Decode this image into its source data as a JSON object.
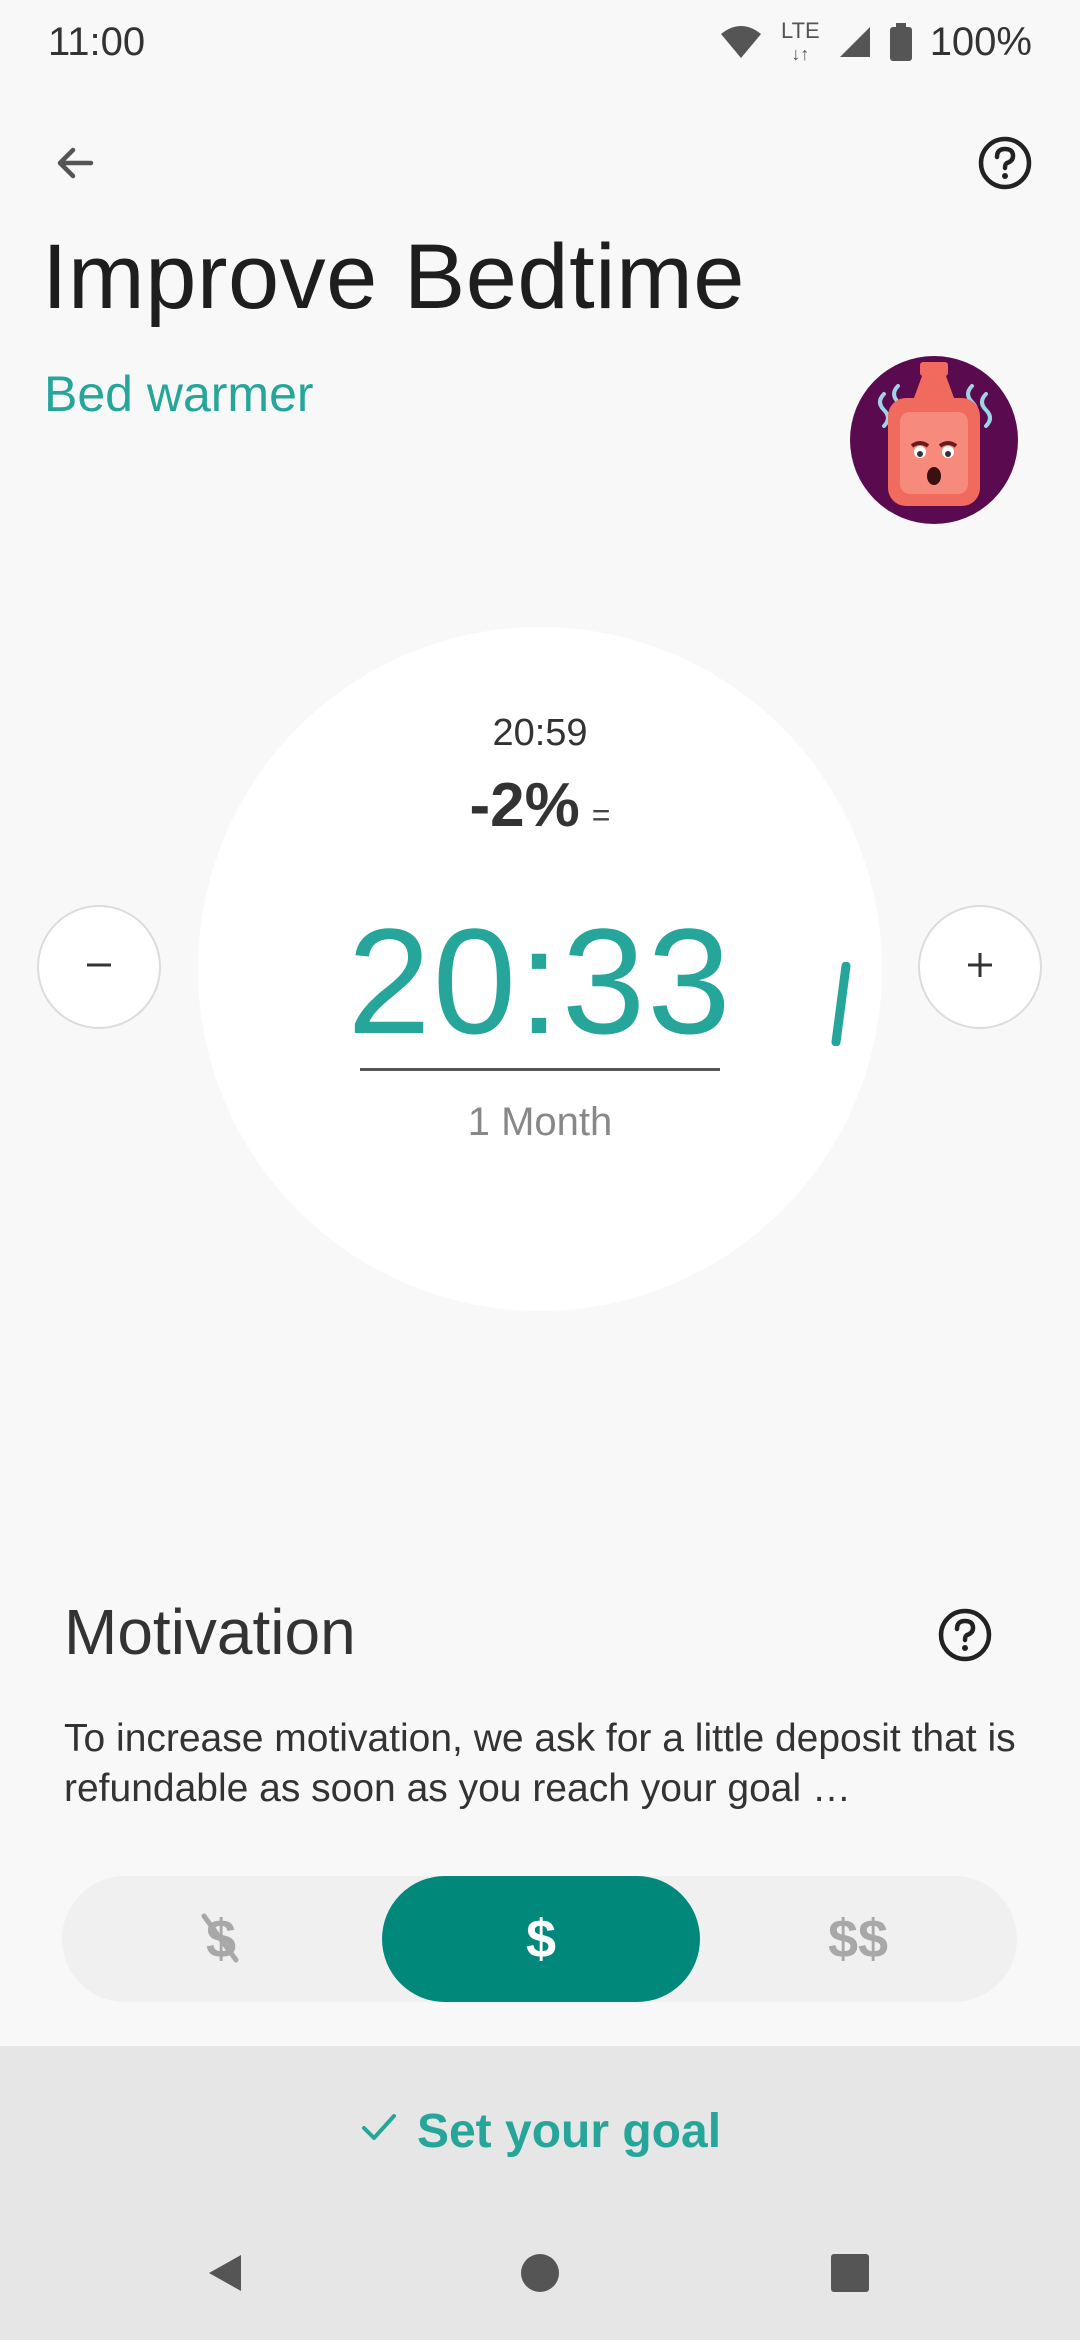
{
  "status_bar": {
    "time": "11:00",
    "network": "LTE",
    "battery": "100%"
  },
  "header": {
    "title": "Improve Bedtime",
    "subtitle": "Bed warmer",
    "avatar_icon": "hot-water-bottle-icon"
  },
  "goal_dial": {
    "previous_time": "20:59",
    "change_percent": "-2%",
    "trend_symbol": "=",
    "target_time": "20:33",
    "period": "1 Month",
    "decrease_label": "−",
    "increase_label": "+"
  },
  "motivation": {
    "title": "Motivation",
    "description": "To increase motivation, we ask for a little deposit that is refundable as soon as you reach your goal …",
    "options": [
      {
        "label": "$",
        "icon": "no-deposit-icon",
        "selected": false
      },
      {
        "label": "$",
        "selected": true
      },
      {
        "label": "$$",
        "selected": false
      }
    ]
  },
  "footer": {
    "cta_label": "Set your goal",
    "cta_icon": "check-icon"
  },
  "colors": {
    "accent": "#26a69a",
    "accent_dark": "#00897b",
    "background": "#f8f8f8",
    "avatar_bg": "#5a0a4e"
  }
}
